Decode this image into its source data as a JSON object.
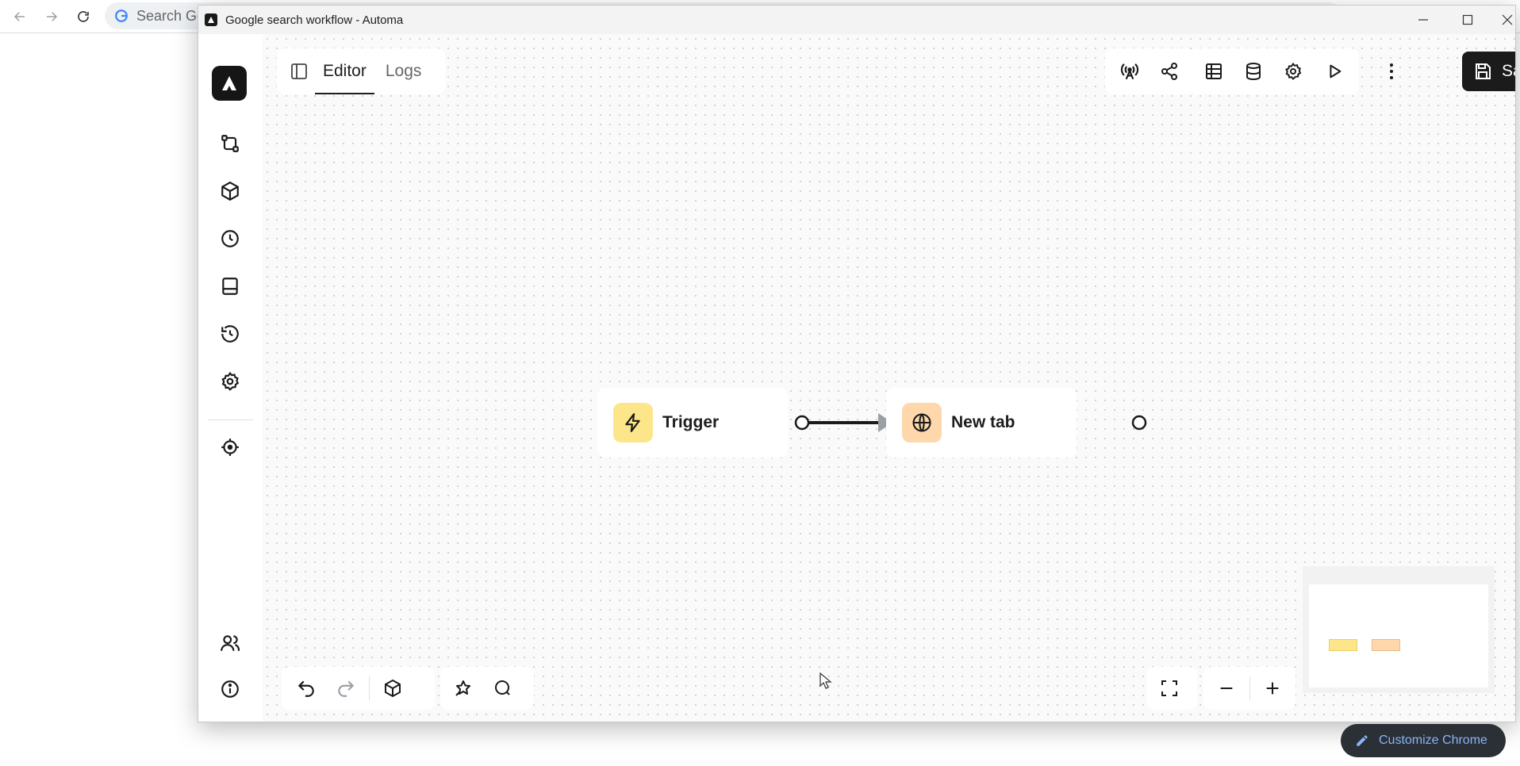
{
  "browser": {
    "omnibox_placeholder": "Search Go"
  },
  "window": {
    "title": "Google search workflow - Automa"
  },
  "editor": {
    "tabs": [
      {
        "label": "Editor",
        "active": true
      },
      {
        "label": "Logs",
        "active": false
      }
    ],
    "save_label": "Save"
  },
  "workflow": {
    "nodes": [
      {
        "label": "Trigger",
        "icon": "bolt-icon",
        "color": "#fde68a"
      },
      {
        "label": "New tab",
        "icon": "globe-icon",
        "color": "#fed7aa"
      }
    ]
  },
  "chrome_footer": {
    "customize_label": "Customize Chrome"
  },
  "colors": {
    "accent_dark": "#1b1b1b",
    "trigger": "#fde68a",
    "new_tab": "#fed7aa",
    "customize_text": "#8ab4f8"
  }
}
